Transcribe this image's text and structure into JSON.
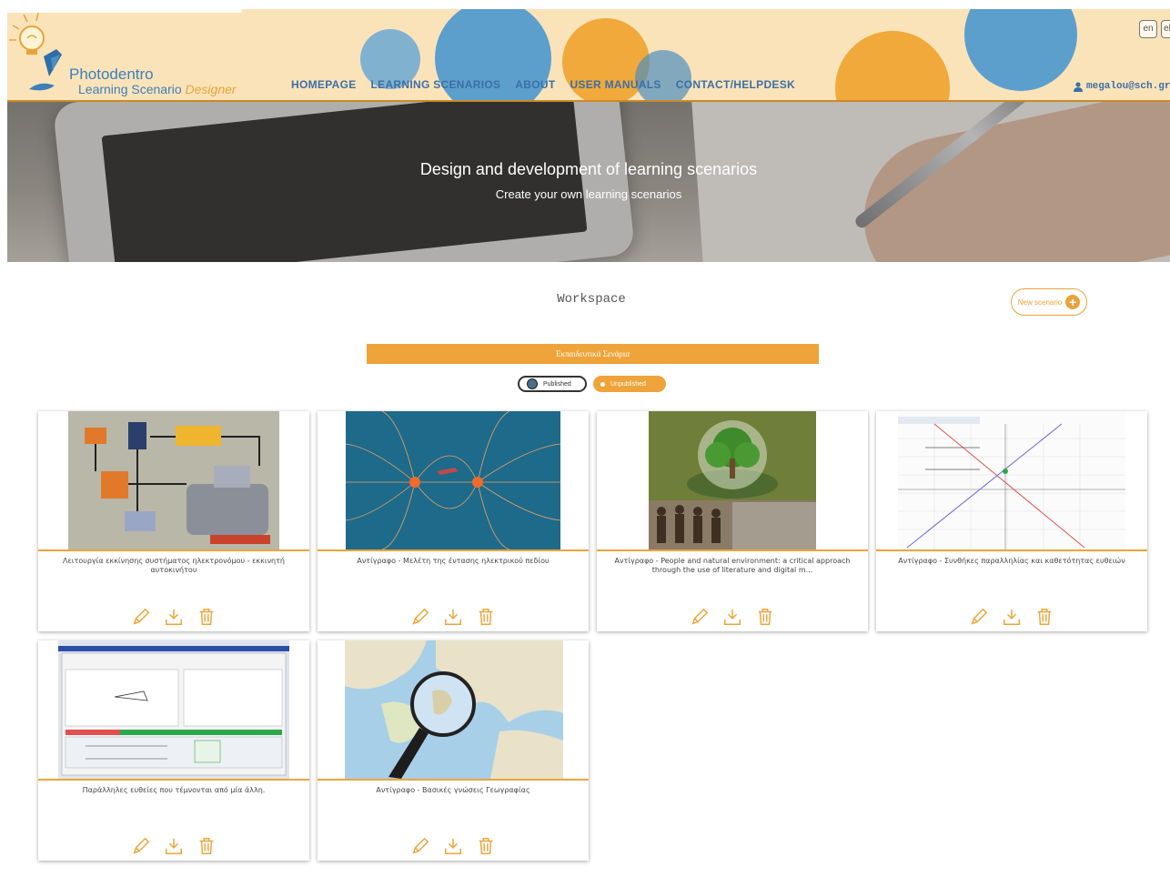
{
  "header": {
    "logo": {
      "line1": "Photodentro",
      "line2_a": "Learning Scenario ",
      "line2_b": "Designer"
    },
    "nav": [
      "HOMEPAGE",
      "LEARNING SCENARIOS",
      "ABOUT",
      "USER MANUALS",
      "CONTACT/HELPDESK"
    ],
    "languages": [
      "en",
      "el"
    ],
    "user": "megalou@sch.gr",
    "colors": {
      "band": "#fbe3b9",
      "orange_circle": "#f0a93a",
      "blue_circle": "#6aa9d3"
    }
  },
  "hero": {
    "title": "Design and development of learning scenarios",
    "subtitle": "Create your own learning scenarios"
  },
  "workspace": {
    "title": "Workspace",
    "new_scenario": "New scenario",
    "section_label": "Εκπαιδευτικά Σενάρια",
    "filters": {
      "published": "Published",
      "unpublished": "Unpublished"
    }
  },
  "cards": [
    {
      "title": "Λειτουργία εκκίνησης συστήματος ηλεκτρονόμου - εκκινητή αυτοκινήτου",
      "thumb": "circuit-diagram"
    },
    {
      "title": "Αντίγραφο - Μελέτη της έντασης ηλεκτρικού πεδίου",
      "thumb": "electric-field"
    },
    {
      "title": "Αντίγραφο - People and natural environment: a critical approach through the use of literature and digital m...",
      "thumb": "tree-and-people"
    },
    {
      "title": "Αντίγραφο - Συνθήκες παραλληλίας και καθετότητας ευθειών",
      "thumb": "geometry-graph"
    },
    {
      "title": "Παράλληλες ευθείες που τέμνονται από μία άλλη.",
      "thumb": "software-window"
    },
    {
      "title": "Αντίγραφο - Βασικές γνώσεις Γεωγραφίας",
      "thumb": "map-magnifier"
    }
  ],
  "card_icons": [
    "pencil-icon",
    "download-icon",
    "trash-icon"
  ],
  "accent": "#eea43a"
}
